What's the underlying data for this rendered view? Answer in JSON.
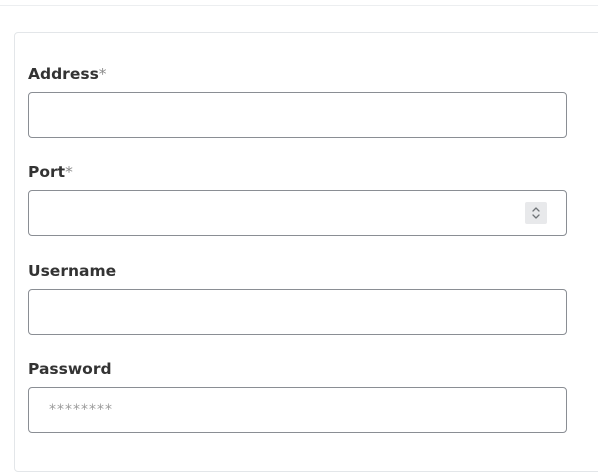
{
  "form": {
    "address": {
      "label": "Address",
      "required_mark": "*",
      "value": "",
      "placeholder": ""
    },
    "port": {
      "label": "Port",
      "required_mark": "*",
      "value": "",
      "placeholder": "",
      "spinner_icon": "number-spinner-icon"
    },
    "username": {
      "label": "Username",
      "value": "",
      "placeholder": ""
    },
    "password": {
      "label": "Password",
      "value": "",
      "placeholder": "********"
    }
  }
}
